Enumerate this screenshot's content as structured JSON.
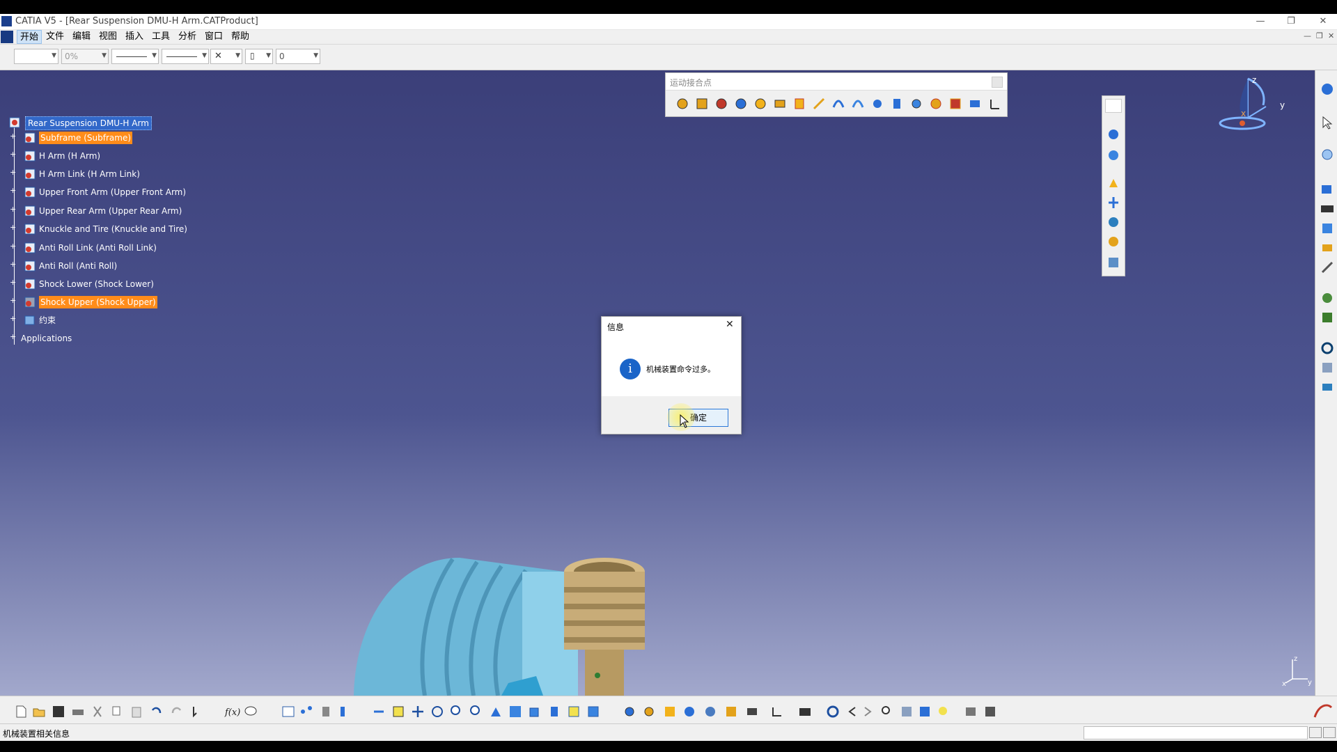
{
  "window": {
    "title": "CATIA V5 - [Rear Suspension DMU-H Arm.CATProduct]",
    "minimize": "—",
    "restore": "❐",
    "close": "✕"
  },
  "menu": [
    "开始",
    "文件",
    "编辑",
    "视图",
    "插入",
    "工具",
    "分析",
    "窗口",
    "帮助"
  ],
  "toolbar": {
    "percent": "0%",
    "layer": "0"
  },
  "tree": {
    "root": "Rear Suspension DMU-H Arm",
    "items": [
      {
        "label": "Subframe (Subframe)",
        "selected": true
      },
      {
        "label": "H Arm (H Arm)",
        "selected": false
      },
      {
        "label": "H Arm Link (H Arm Link)",
        "selected": false
      },
      {
        "label": "Upper Front Arm (Upper Front Arm)",
        "selected": false
      },
      {
        "label": "Upper Rear Arm (Upper Rear Arm)",
        "selected": false
      },
      {
        "label": "Knuckle and Tire (Knuckle and Tire)",
        "selected": false
      },
      {
        "label": "Anti Roll Link (Anti Roll Link)",
        "selected": false
      },
      {
        "label": "Anti Roll (Anti Roll)",
        "selected": false
      },
      {
        "label": "Shock Lower (Shock Lower)",
        "selected": false
      },
      {
        "label": "Shock Upper (Shock Upper)",
        "selected": true
      }
    ],
    "constraints": "约束",
    "applications": "Applications"
  },
  "kinematics_toolbar": {
    "title": "运动接合点"
  },
  "compass": {
    "z": "z",
    "y": "y",
    "x": "x"
  },
  "mini_axis": {
    "z": "z",
    "y": "y",
    "x": "x"
  },
  "dialog": {
    "title": "信息",
    "message": "机械装置命令过多。",
    "ok": "确定",
    "close": "✕",
    "info_glyph": "i"
  },
  "status": {
    "text": "机械装置相关信息"
  },
  "colors": {
    "selection": "#ff8c1a",
    "viewport_top": "#3b3f79",
    "viewport_bottom": "#a2a8cc",
    "tire": "#7ec6e2",
    "shock": "#c9ad78",
    "info_blue": "#1a64c8"
  }
}
